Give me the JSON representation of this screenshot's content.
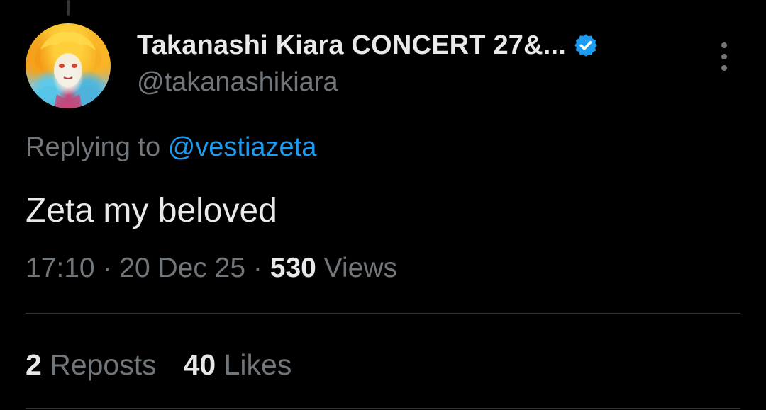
{
  "tweet": {
    "author": {
      "display_name": "Takanashi Kiara CONCERT 27&...",
      "handle": "@takanashikiara",
      "verified": true
    },
    "reply": {
      "prefix": "Replying to ",
      "target": "@vestiazeta"
    },
    "text": "Zeta my beloved",
    "meta": {
      "time": "17:10",
      "separator1": " · ",
      "date": "20 Dec 25",
      "separator2": " · ",
      "views_count": "530",
      "views_label": " Views"
    },
    "stats": {
      "reposts_count": "2",
      "reposts_label": " Reposts",
      "likes_count": "40",
      "likes_label": " Likes"
    }
  },
  "icons": {
    "verified": "verified-badge-icon",
    "more": "more-vertical-icon"
  },
  "colors": {
    "background": "#000000",
    "primary_text": "#e7e9ea",
    "secondary_text": "#71767b",
    "link": "#1d9bf0",
    "divider": "#2f3336"
  }
}
